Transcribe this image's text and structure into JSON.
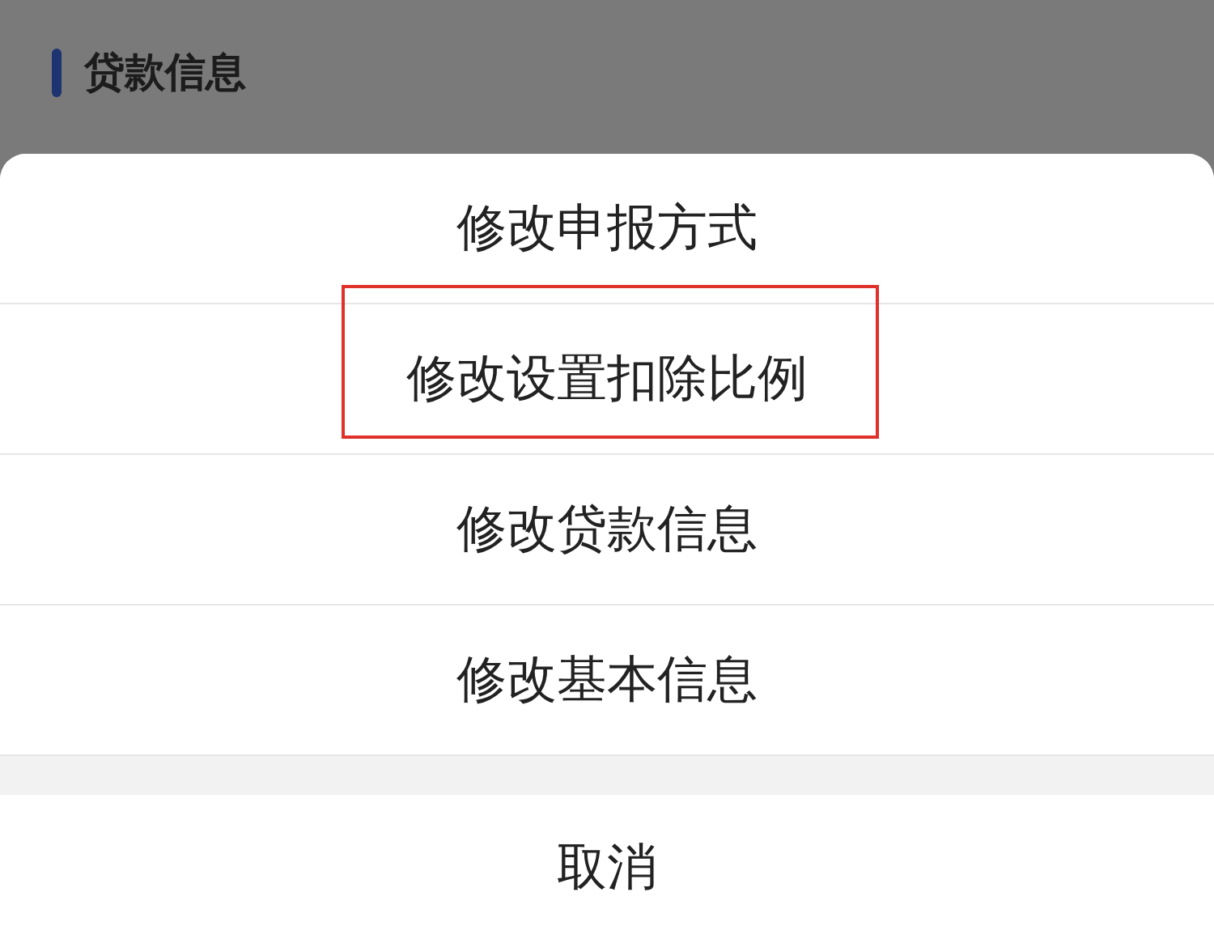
{
  "header": {
    "title": "贷款信息"
  },
  "action_sheet": {
    "options": [
      {
        "label": "修改申报方式",
        "highlighted": false
      },
      {
        "label": "修改设置扣除比例",
        "highlighted": true
      },
      {
        "label": "修改贷款信息",
        "highlighted": false
      },
      {
        "label": "修改基本信息",
        "highlighted": false
      }
    ],
    "cancel": "取消"
  }
}
